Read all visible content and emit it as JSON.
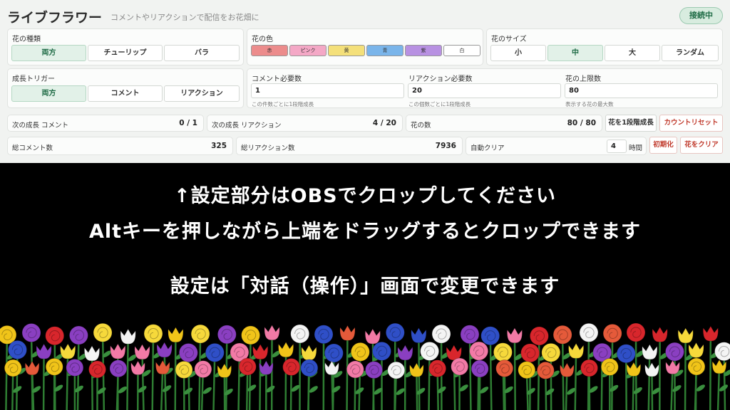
{
  "header": {
    "title": "ライブフラワー",
    "subtitle": "コメントやリアクションで配信をお花畑に",
    "connection_status": "接続中"
  },
  "flower_type": {
    "label": "花の種類",
    "options": [
      "両方",
      "チューリップ",
      "バラ"
    ],
    "selected": "両方"
  },
  "flower_color": {
    "label": "花の色",
    "options": [
      {
        "label": "赤",
        "color": "#ec8c8c"
      },
      {
        "label": "ピンク",
        "color": "#f4a8c6"
      },
      {
        "label": "黄",
        "color": "#f4e07a"
      },
      {
        "label": "青",
        "color": "#7ab5ea"
      },
      {
        "label": "紫",
        "color": "#b891e2"
      },
      {
        "label": "白",
        "color": "#ffffff"
      }
    ]
  },
  "flower_size": {
    "label": "花のサイズ",
    "options": [
      "小",
      "中",
      "大",
      "ランダム"
    ],
    "selected": "中"
  },
  "growth_trigger": {
    "label": "成長トリガー",
    "options": [
      "両方",
      "コメント",
      "リアクション"
    ],
    "selected": "両方"
  },
  "thresholds": {
    "comment_required": {
      "label": "コメント必要数",
      "value": "1",
      "hint": "この件数ごとに1段階成長"
    },
    "reaction_required": {
      "label": "リアクション必要数",
      "value": "20",
      "hint": "この個数ごとに1段階成長"
    },
    "flower_limit": {
      "label": "花の上限数",
      "value": "80",
      "hint": "表示する花の最大数"
    }
  },
  "stats": {
    "next_comment": {
      "label": "次の成長 コメント",
      "value": "0 / 1"
    },
    "next_reaction": {
      "label": "次の成長 リアクション",
      "value": "4 / 20"
    },
    "flower_count": {
      "label": "花の数",
      "value": "80 / 80"
    },
    "total_comments": {
      "label": "総コメント数",
      "value": "325"
    },
    "total_reactions": {
      "label": "総リアクション数",
      "value": "7936"
    },
    "auto_clear": {
      "label": "自動クリア",
      "value": "4",
      "unit": "時間"
    }
  },
  "actions": {
    "grow_one": "花を1段階成長",
    "reset_count": "カウントリセット",
    "initialize": "初期化",
    "clear_flowers": "花をクリア"
  },
  "notice": {
    "line1": "↑設定部分はOBSでクロップしてください",
    "line2": "Altキーを押しながら上端をドラッグするとクロップできます",
    "line3": "設定は「対話（操作）」画面で変更できます"
  },
  "colors": {
    "accent_green": "#1e6b45",
    "danger_red": "#c0392b",
    "panel_bg": "#f1f3f1"
  }
}
